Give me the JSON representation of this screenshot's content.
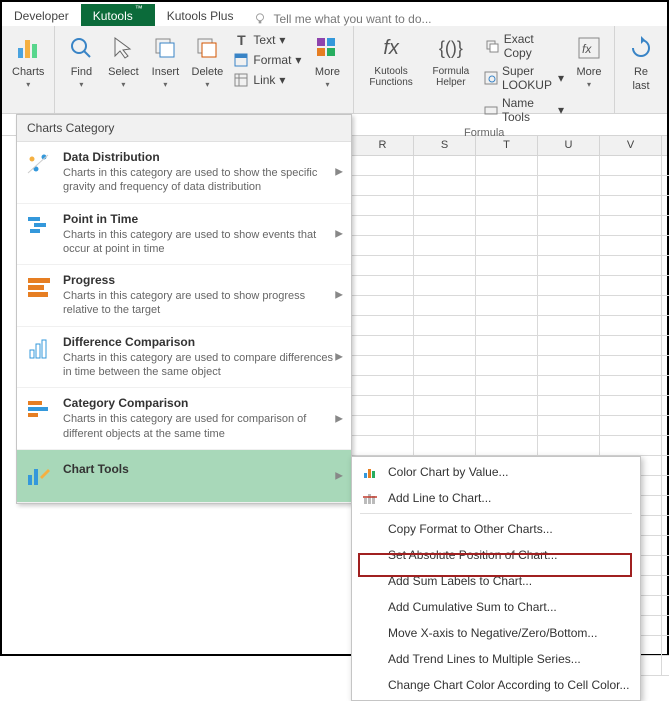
{
  "tabs": {
    "developer": "Developer",
    "kutools": "Kutools",
    "kutoolsplus": "Kutools Plus",
    "tellme": "Tell me what you want to do..."
  },
  "ribbon": {
    "charts": "Charts",
    "find": "Find",
    "select": "Select",
    "insert": "Insert",
    "delete": "Delete",
    "text": "Text",
    "format": "Format",
    "link": "Link",
    "more1": "More",
    "kutoolsfn": "Kutools Functions",
    "formulahelper": "Formula Helper",
    "formulamore": "More",
    "exactcopy": "Exact Copy",
    "superlookup": "Super LOOKUP",
    "nametools": "Name Tools",
    "re": "Re",
    "last": "last",
    "formula_group": "Formula"
  },
  "dropdown": {
    "header": "Charts Category",
    "items": [
      {
        "title": "Data Distribution",
        "desc": "Charts in this category are used to show the specific gravity and frequency of data distribution"
      },
      {
        "title": "Point in Time",
        "desc": "Charts in this category are used to show events that occur at point in time"
      },
      {
        "title": "Progress",
        "desc": "Charts in this category are used to show progress relative to the target"
      },
      {
        "title": "Difference Comparison",
        "desc": "Charts in this category are used to compare differences in time between the same object"
      },
      {
        "title": "Category Comparison",
        "desc": "Charts in this category are used for comparison of different objects at the same time"
      },
      {
        "title": "Chart Tools",
        "desc": ""
      }
    ]
  },
  "submenu": [
    "Color Chart by Value...",
    "Add Line to Chart...",
    "Copy Format to Other Charts...",
    "Set Absolute Position of Chart...",
    "Add Sum Labels to Chart...",
    "Add Cumulative Sum to Chart...",
    "Move X-axis to Negative/Zero/Bottom...",
    "Add Trend Lines to Multiple Series...",
    "Change Chart Color According to Cell Color..."
  ],
  "cols": [
    "R",
    "S",
    "T",
    "U",
    "V"
  ]
}
